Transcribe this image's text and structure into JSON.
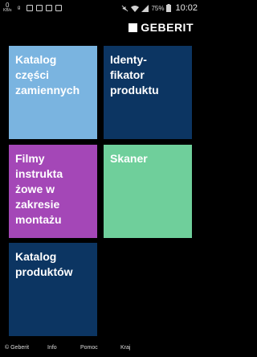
{
  "status_bar": {
    "data_speed_value": "0",
    "data_speed_unit": "KB/s",
    "battery_percent": "75%",
    "time": "10:02",
    "icons": [
      "network-speed-icon",
      "notification-g-icon",
      "bag-icon",
      "bag-icon",
      "bag-icon",
      "bag-icon",
      "mute-icon",
      "wifi-icon",
      "signal-icon",
      "battery-icon"
    ]
  },
  "header": {
    "logo_text": "GEBERIT"
  },
  "tiles": [
    {
      "label": "Katalog\nczęści\nzamiennych",
      "color": "#7ab4e0"
    },
    {
      "label": "Identy-\nfikator\nproduktu",
      "color": "#0c3562"
    },
    {
      "label": "Filmy\ninstrukta\nżowe w\nzakresie\nmontażu",
      "color": "#a447b7"
    },
    {
      "label": "Skaner",
      "color": "#6fcf9b"
    },
    {
      "label": "Katalog\nproduktów",
      "color": "#0c3562"
    }
  ],
  "footer": {
    "copyright": "© Geberit",
    "info": "Info",
    "help": "Pomoc",
    "country": "Kraj"
  }
}
